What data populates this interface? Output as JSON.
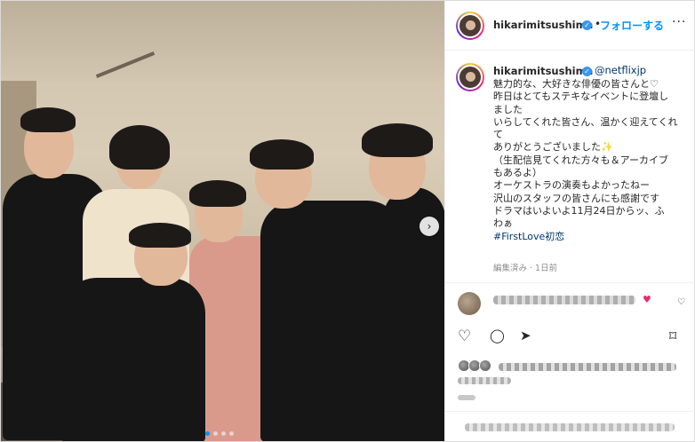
{
  "post": {
    "username": "hikarimitsushima",
    "follow_label": "フォローする",
    "header_separator": "•",
    "more_icon": "···",
    "mention": "@netflixjp",
    "caption_lines": [
      "魅力的な、大好きな俳優の皆さんと♡",
      "昨日はとてもステキなイベントに登壇し",
      "ました",
      "いらしてくれた皆さん、温かく迎えてくれ",
      "て",
      "ありがとうございました✨",
      "（生配信見てくれた方々も＆アーカイブ",
      "もあるよ）",
      "オーケストラの演奏もよかったねー",
      "沢山のスタッフの皆さんにも感謝です",
      "ドラマはいよいよ11月24日からッ、ふ",
      "わぁ"
    ],
    "hashtag": "#FirstLove初恋",
    "meta": "編集済み · 1日前",
    "carousel_dots": 4,
    "active_dot": 0
  },
  "icons": {
    "verified": "✓",
    "carousel_next": "›",
    "like": "♡",
    "comment": "◯",
    "share": "➤",
    "save": "⌑",
    "comment_heart": "♥",
    "comment_like": "♡"
  },
  "colors": {
    "accent": "#0095f6",
    "verified": "#3897f0",
    "link": "#00376b",
    "meta": "#8e8e8e"
  }
}
